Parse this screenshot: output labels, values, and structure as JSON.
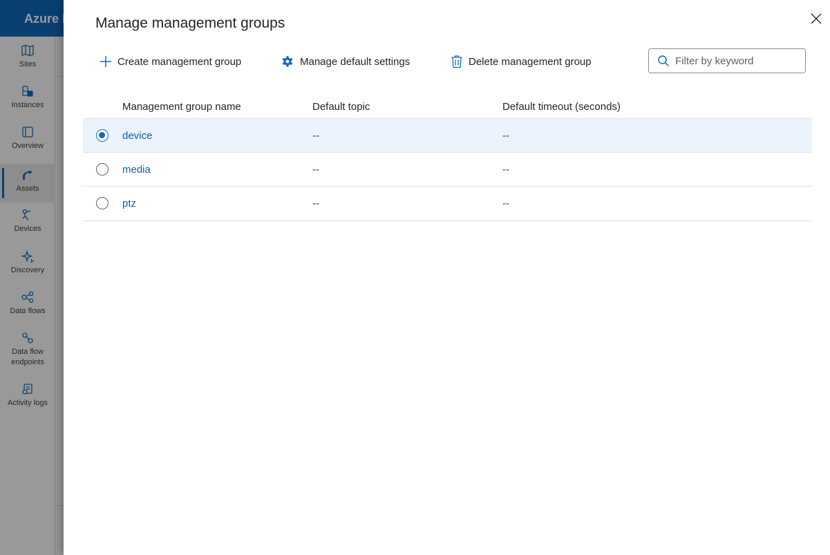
{
  "app": {
    "title": "Azure I",
    "nav": [
      {
        "label": "Sites",
        "icon": "book-map-icon"
      },
      {
        "label": "Instances",
        "icon": "instances-icon"
      },
      {
        "label": "Overview",
        "icon": "overview-icon"
      },
      {
        "label": "Assets",
        "icon": "assets-icon",
        "active": true
      },
      {
        "label": "Devices",
        "icon": "devices-icon"
      },
      {
        "label": "Discovery",
        "icon": "sparkle-icon"
      },
      {
        "label": "Data flows",
        "icon": "data-flows-icon"
      },
      {
        "label": "Data flow endpoints",
        "icon": "data-flow-endpoints-icon"
      },
      {
        "label": "Activity logs",
        "icon": "activity-logs-icon"
      }
    ]
  },
  "dialog": {
    "title": "Manage management groups",
    "toolbar": {
      "create": "Create management group",
      "settings": "Manage default settings",
      "delete": "Delete management group"
    },
    "search": {
      "placeholder": "Filter by keyword",
      "value": ""
    },
    "table": {
      "columns": [
        "Management group name",
        "Default topic",
        "Default timeout (seconds)"
      ],
      "rows": [
        {
          "name": "device",
          "topic": "--",
          "timeout": "--",
          "selected": true
        },
        {
          "name": "media",
          "topic": "--",
          "timeout": "--",
          "selected": false
        },
        {
          "name": "ptz",
          "topic": "--",
          "timeout": "--",
          "selected": false
        }
      ]
    }
  },
  "colors": {
    "accent": "#0f6cbd",
    "link": "#115ea3",
    "selected_row": "#ebf3fc"
  }
}
